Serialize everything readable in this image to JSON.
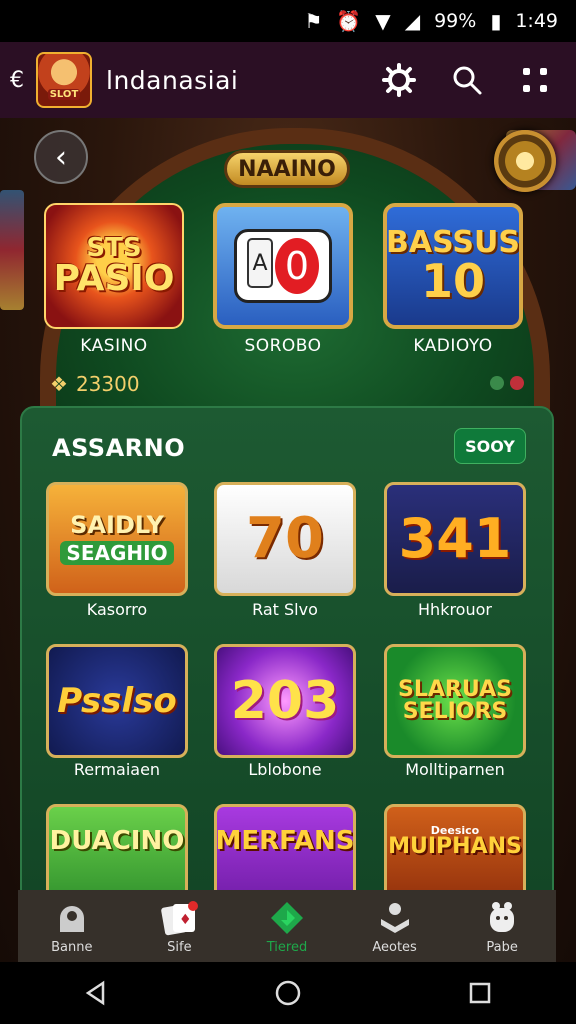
{
  "status_bar": {
    "battery": "99%",
    "time": "1:49"
  },
  "app_bar": {
    "title": "lndanasiai"
  },
  "hero": {
    "badge": "NAAINO",
    "balance": "23300"
  },
  "featured": [
    {
      "art_top": "STS",
      "art_main": "PASIO",
      "label": "KASINO"
    },
    {
      "art_left": "A",
      "art_main": "0",
      "label": "SOROBO"
    },
    {
      "art_top": "BASSUS",
      "art_main": "10",
      "label": "KADIOYO"
    }
  ],
  "panel": {
    "title": "ASSARNO",
    "button": "SOOY",
    "tiles": [
      {
        "art_top": "SAIDLY",
        "art_main": "SEAGHIO",
        "label": "Kasorro"
      },
      {
        "art_main": "70",
        "label": "Rat Slvo"
      },
      {
        "art_main": "341",
        "label": "Hhkrouor"
      },
      {
        "art_main": "Psslso",
        "label": "Rermaiaen"
      },
      {
        "art_main": "203",
        "label": "Lblobone"
      },
      {
        "art_top": "SLARUAS",
        "art_main": "SELIORS",
        "label": "Molltiparnen"
      },
      {
        "art_main": "DUACINO",
        "label": ""
      },
      {
        "art_main": "MERFANS",
        "label": ""
      },
      {
        "art_top": "Deesico",
        "art_main": "MUIPHANS",
        "label": ""
      }
    ]
  },
  "bottom_nav": [
    {
      "label": "Banne",
      "icon": "home-icon"
    },
    {
      "label": "Sife",
      "icon": "cards-icon"
    },
    {
      "label": "Tiered",
      "icon": "diamond-icon"
    },
    {
      "label": "Aeotes",
      "icon": "user-group-icon"
    },
    {
      "label": "Pabe",
      "icon": "profile-icon"
    }
  ]
}
